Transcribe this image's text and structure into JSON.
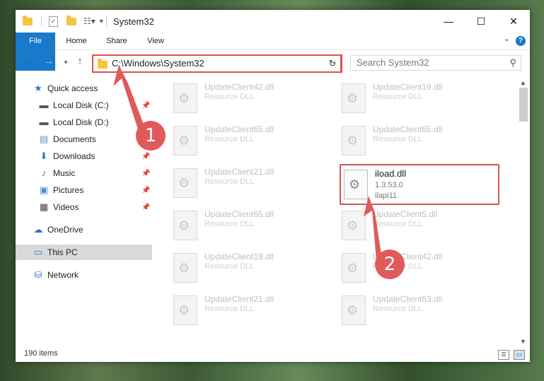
{
  "window": {
    "title": "System32",
    "controls": {
      "minimize": "—",
      "maximize": "☐",
      "close": "✕"
    }
  },
  "ribbon": {
    "tabs": [
      "File",
      "Home",
      "Share",
      "View"
    ],
    "help": "?"
  },
  "nav": {
    "address": "C:\\Windows\\System32",
    "search_placeholder": "Search System32"
  },
  "sidebar": {
    "items": [
      {
        "label": "Quick access",
        "icon": "star-icon",
        "pinned": false
      },
      {
        "label": "Local Disk (C:)",
        "icon": "drive-icon",
        "pinned": true
      },
      {
        "label": "Local Disk (D:)",
        "icon": "drive-icon",
        "pinned": false
      },
      {
        "label": "Documents",
        "icon": "documents-icon",
        "pinned": true
      },
      {
        "label": "Downloads",
        "icon": "download-icon",
        "pinned": true
      },
      {
        "label": "Music",
        "icon": "music-icon",
        "pinned": true
      },
      {
        "label": "Pictures",
        "icon": "pictures-icon",
        "pinned": true
      },
      {
        "label": "Videos",
        "icon": "videos-icon",
        "pinned": true
      },
      {
        "label": "OneDrive",
        "icon": "cloud-icon",
        "pinned": false
      },
      {
        "label": "This PC",
        "icon": "computer-icon",
        "pinned": false,
        "selected": true
      },
      {
        "label": "Network",
        "icon": "network-icon",
        "pinned": false
      }
    ]
  },
  "files": [
    {
      "name": "UpdateClient42.dll",
      "type": "Resource DLL"
    },
    {
      "name": "UpdateClient19.dll",
      "type": "Resource DLL"
    },
    {
      "name": "UpdateClient65.dll",
      "type": "Resource DLL"
    },
    {
      "name": "UpdateClient65.dll",
      "type": "Resource DLL"
    },
    {
      "name": "UpdateClient21.dll",
      "type": "Resource DLL"
    },
    {
      "name": "iload.dll",
      "version": "1.3.53.0",
      "description": "ilapi11",
      "highlighted": true
    },
    {
      "name": "UpdateClient65.dll",
      "type": "Resource DLL"
    },
    {
      "name": "UpdateClient5.dll",
      "type": "Resource DLL"
    },
    {
      "name": "UpdateClient19.dll",
      "type": "Resource DLL"
    },
    {
      "name": "UpdateClient42.dll",
      "type": "Resource DLL"
    },
    {
      "name": "UpdateClient21.dll",
      "type": "Resource DLL"
    },
    {
      "name": "UpdateClient63.dll",
      "type": "Resource DLL"
    }
  ],
  "status": {
    "items": "190 items"
  },
  "annotations": {
    "step1": "1",
    "step2": "2",
    "color": "#e05a5a"
  }
}
